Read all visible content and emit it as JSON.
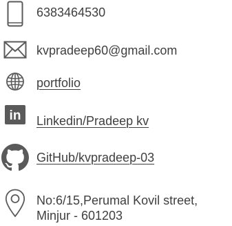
{
  "contact": {
    "phone": {
      "icon": "smartphone-icon",
      "text": "6383464530"
    },
    "email": {
      "icon": "envelope-icon",
      "text": "kvpradeep60@gmail.com"
    },
    "portfolio": {
      "icon": "globe-icon",
      "text": "portfolio"
    },
    "linkedin": {
      "icon": "linkedin-icon",
      "logo_text": "in",
      "text": "Linkedin/Pradeep kv"
    },
    "github": {
      "icon": "github-icon",
      "text": "GitHub/kvpradeep-03"
    },
    "address": {
      "icon": "location-pin-icon",
      "line1": "No:6/15,Perumal Kovil street,",
      "line2": "Minjur - 601203"
    }
  },
  "colors": {
    "text": "#3f3f3f",
    "icon": "#5a5a5a"
  }
}
